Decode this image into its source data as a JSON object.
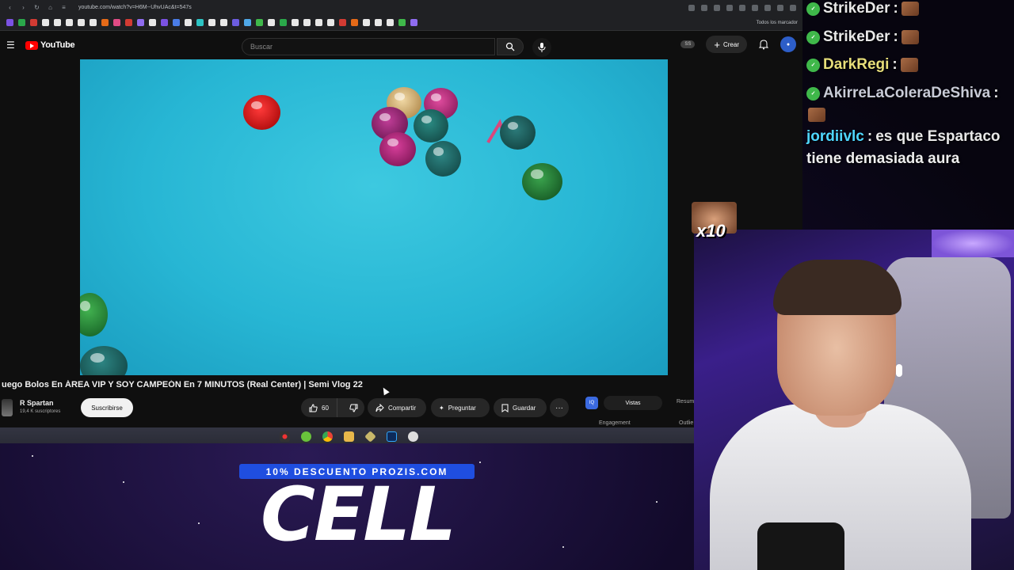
{
  "browser": {
    "url": "youtube.com/watch?v=H6M--UhvUAc&t=547s",
    "bookmarks_all": "Todos los marcador"
  },
  "youtube": {
    "logo_text": "YouTube",
    "search_placeholder": "Buscar",
    "ss_badge": "SS",
    "create_label": "Crear"
  },
  "video": {
    "title": "uego Bolos En ÁREA VIP Y SOY CAMPEÓN En 7 MINUTOS (Real Center) | Semi Vlog 22",
    "channel": "R Spartan",
    "subscribers": "19,4 K suscriptores",
    "subscribe_label": "Suscribirse",
    "likes": "60",
    "share_label": "Compartir",
    "ask_label": "Preguntar",
    "save_label": "Guardar",
    "more_label": "···"
  },
  "extension": {
    "icon_label": "IQ",
    "tab_active": "Vistas",
    "tab_other": "Resum",
    "sub1": "Engagement",
    "sub2": "Outlie"
  },
  "chat": {
    "lines": [
      {
        "user": "StrikeDer",
        "sep": " :"
      },
      {
        "user": "StrikeDer",
        "sep": " :"
      },
      {
        "user": "DarkRegi",
        "sep": " :"
      },
      {
        "user": "AkirreLaColeraDeShiva",
        "sep": " :"
      },
      {
        "user": "jordiivlc",
        "sep": " :",
        "message": "es que Espartaco"
      }
    ],
    "message_cont": "tiene demasiada aura"
  },
  "overlay": {
    "emote_count": "x10",
    "promo_banner": "10% DESCUENTO PROZIS.COM",
    "promo_code": "CELL"
  },
  "colors": {
    "yt_red": "#ff0000",
    "table_cloth": "#27b6d4",
    "promo_blue": "#1f4ee0",
    "chat_badge": "#3fb84a"
  }
}
